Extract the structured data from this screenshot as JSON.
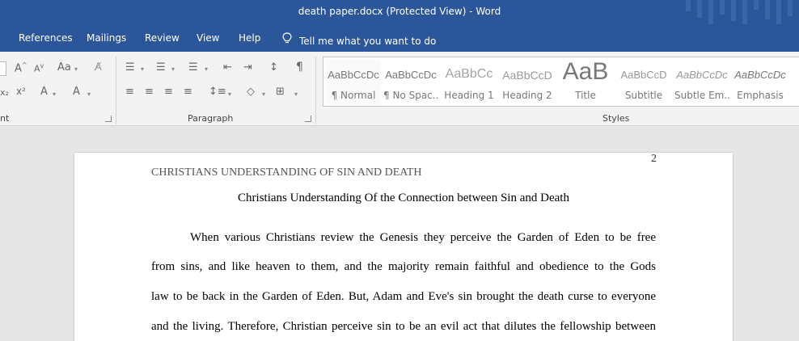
{
  "window": {
    "title": "death paper.docx (Protected View)  -  Word"
  },
  "menu": {
    "tabs": [
      "References",
      "Mailings",
      "Review",
      "View",
      "Help"
    ],
    "tell_me": "Tell me what you want to do"
  },
  "ribbon": {
    "groups": {
      "font_partial": "nt",
      "paragraph": "Paragraph",
      "styles": "Styles"
    },
    "styles_gallery": [
      {
        "preview": "AaBbCcDc",
        "name": "¶ Normal"
      },
      {
        "preview": "AaBbCcDc",
        "name": "¶ No Spac..."
      },
      {
        "preview": "AaBbCc",
        "name": "Heading 1"
      },
      {
        "preview": "AaBbCcD",
        "name": "Heading 2"
      },
      {
        "preview": "AaB",
        "name": "Title"
      },
      {
        "preview": "AaBbCcD",
        "name": "Subtitle"
      },
      {
        "preview": "AaBbCcDc",
        "name": "Subtle Em..."
      },
      {
        "preview": "AaBbCcDc",
        "name": "Emphasis"
      }
    ]
  },
  "document": {
    "page_number": "2",
    "running_head": "CHRISTIANS UNDERSTANDING OF SIN AND DEATH",
    "title": "Christians Understanding Of the Connection between Sin and Death",
    "lines": [
      "When various Christians review the Genesis they perceive the Garden of Eden to be free",
      "from sins, and like heaven to them, and the majority remain faithful and obedience to the Gods",
      "law to be back in the Garden of Eden. But, Adam and Eve's sin brought the death curse to everyone",
      "and the living. Therefore, Christian perceive sin to be an evil act that dilutes the fellowship between"
    ]
  }
}
